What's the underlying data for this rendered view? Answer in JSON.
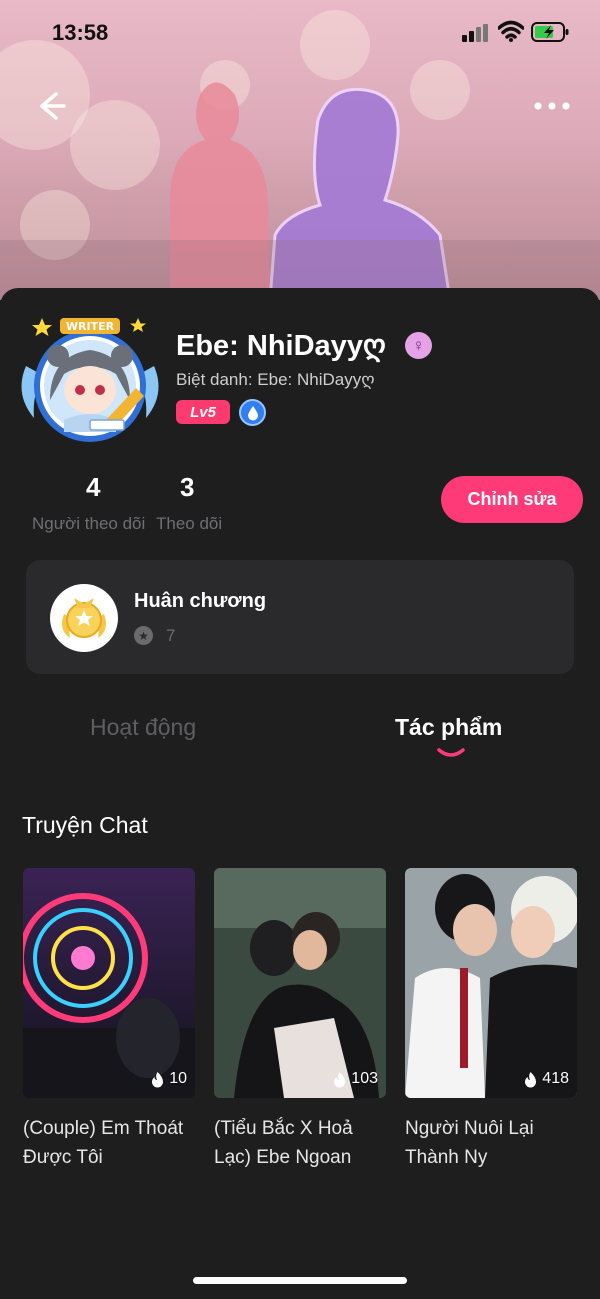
{
  "status_bar": {
    "time": "13:58"
  },
  "profile": {
    "name": "Ebe: NhiDayyღ",
    "nickname": "Biệt danh: Ebe: NhiDayyღ",
    "level_badge": "Lv5",
    "gender_symbol": "♀",
    "avatar_banner": "WRITER"
  },
  "stats": {
    "followers": {
      "value": "4",
      "label": "Người theo dõi"
    },
    "following": {
      "value": "3",
      "label": "Theo dõi"
    }
  },
  "edit_button": "Chỉnh sửa",
  "medal": {
    "title": "Huân chương",
    "count": "7"
  },
  "tabs": [
    {
      "label": "Hoạt động",
      "active": false
    },
    {
      "label": "Tác phẩm",
      "active": true
    }
  ],
  "section_title": "Truyện Chat",
  "stories": [
    {
      "title": "(Couple) Em Thoát Được Tôi",
      "count": "10"
    },
    {
      "title": "(Tiểu Bắc X Hoả Lạc) Ebe Ngoan",
      "count": "103"
    },
    {
      "title": "Người Nuôi Lại Thành Ny",
      "count": "418"
    }
  ],
  "colors": {
    "accent": "#ff3a78",
    "level_badge": "#ff3a6e",
    "background": "#1e1e1f",
    "card": "#2a2a2c"
  },
  "icons": {
    "back": "back-arrow-icon",
    "more": "more-dots-icon",
    "gender": "female-icon",
    "medal_star": "star-icon",
    "count": "flame-icon"
  }
}
